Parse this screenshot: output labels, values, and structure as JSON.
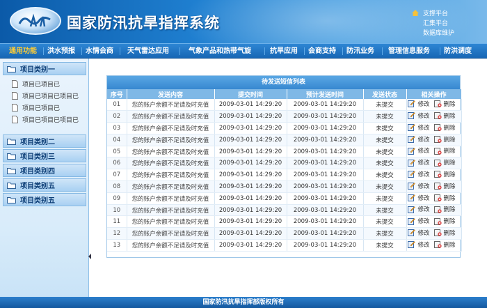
{
  "header": {
    "title": "国家防汛抗旱指挥系统",
    "links": [
      "支撑平台",
      "汇集平台",
      "数据库维护"
    ]
  },
  "nav": {
    "items": [
      "通用功能",
      "洪水预报",
      "水情会商",
      "天气雷达应用",
      "气象产品和热带气旋",
      "抗旱应用",
      "会商支持",
      "防汛业务",
      "管理信息服务",
      "防洪调度"
    ],
    "active": "通用功能"
  },
  "sidebar": {
    "categories": [
      "项目类别一",
      "项目类别二",
      "项目类别三",
      "项目类别四",
      "项目类别五",
      "项目类别五"
    ],
    "sub_items": [
      "项目已项目已",
      "项目已项目已项目已",
      "项目已项目已",
      "项目已项目已项目已"
    ]
  },
  "table": {
    "title": "待发送短信列表",
    "columns": [
      "序号",
      "发送内容",
      "提交时间",
      "预计发送时间",
      "发送状态",
      "相关操作"
    ],
    "edit_label": "修改",
    "delete_label": "删除",
    "rows": [
      {
        "idx": "01",
        "content": "您的账户余额不足请及时充值",
        "submit": "2009-03-01 14:29:20",
        "send": "2009-03-01 14:29:20",
        "status": "未提交"
      },
      {
        "idx": "02",
        "content": "您的账户余额不足请及时充值",
        "submit": "2009-03-01 14:29:20",
        "send": "2009-03-01 14:29:20",
        "status": "未提交"
      },
      {
        "idx": "03",
        "content": "您的账户余额不足请及时充值",
        "submit": "2009-03-01 14:29:20",
        "send": "2009-03-01 14:29:20",
        "status": "未提交"
      },
      {
        "idx": "04",
        "content": "您的账户余额不足请及时充值",
        "submit": "2009-03-01 14:29:20",
        "send": "2009-03-01 14:29:20",
        "status": "未提交"
      },
      {
        "idx": "05",
        "content": "您的账户余额不足请及时充值",
        "submit": "2009-03-01 14:29:20",
        "send": "2009-03-01 14:29:20",
        "status": "未提交"
      },
      {
        "idx": "06",
        "content": "您的账户余额不足请及时充值",
        "submit": "2009-03-01 14:29:20",
        "send": "2009-03-01 14:29:20",
        "status": "未提交"
      },
      {
        "idx": "07",
        "content": "您的账户余额不足请及时充值",
        "submit": "2009-03-01 14:29:20",
        "send": "2009-03-01 14:29:20",
        "status": "未提交"
      },
      {
        "idx": "08",
        "content": "您的账户余额不足请及时充值",
        "submit": "2009-03-01 14:29:20",
        "send": "2009-03-01 14:29:20",
        "status": "未提交"
      },
      {
        "idx": "09",
        "content": "您的账户余额不足请及时充值",
        "submit": "2009-03-01 14:29:20",
        "send": "2009-03-01 14:29:20",
        "status": "未提交"
      },
      {
        "idx": "10",
        "content": "您的账户余额不足请及时充值",
        "submit": "2009-03-01 14:29:20",
        "send": "2009-03-01 14:29:20",
        "status": "未提交"
      },
      {
        "idx": "11",
        "content": "您的账户余额不足请及时充值",
        "submit": "2009-03-01 14:29:20",
        "send": "2009-03-01 14:29:20",
        "status": "未提交"
      },
      {
        "idx": "12",
        "content": "您的账户余额不足请及时充值",
        "submit": "2009-03-01 14:29:20",
        "send": "2009-03-01 14:29:20",
        "status": "未提交"
      },
      {
        "idx": "13",
        "content": "您的账户余额不足请及时充值",
        "submit": "2009-03-01 14:29:20",
        "send": "2009-03-01 14:29:20",
        "status": "未提交"
      }
    ]
  },
  "footer": {
    "text": "国家防汛抗旱指挥部版权所有"
  },
  "colors": {
    "accent": "#1766b4",
    "active_nav": "#ffcc33",
    "header_table": "#7fb8e6"
  }
}
